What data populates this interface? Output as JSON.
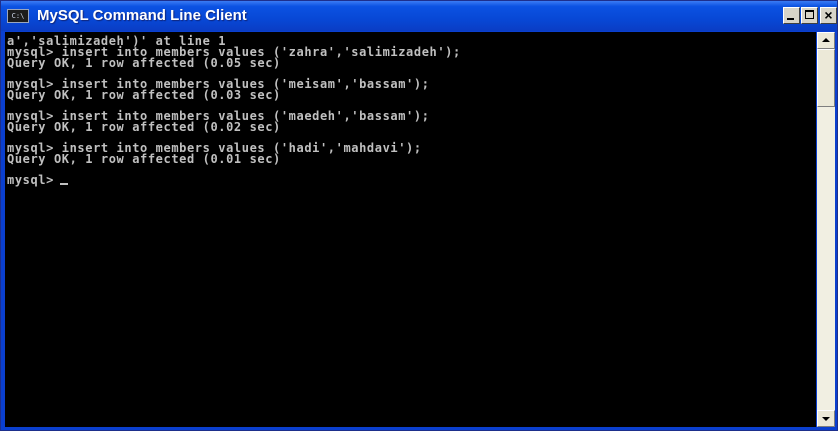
{
  "window": {
    "title": "MySQL Command Line Client",
    "system_icon_text": "C:\\",
    "buttons": {
      "minimize": "minimize-icon",
      "maximize": "maximize-icon",
      "close": "close-icon",
      "close_label": "×"
    }
  },
  "console": {
    "lines": [
      "a','salimizadeh')' at line 1",
      "mysql> insert into members values ('zahra','salimizadeh');",
      "Query OK, 1 row affected (0.05 sec)",
      "",
      "mysql> insert into members values ('meisam','bassam');",
      "Query OK, 1 row affected (0.03 sec)",
      "",
      "mysql> insert into members values ('maedeh','bassam');",
      "Query OK, 1 row affected (0.02 sec)",
      "",
      "mysql> insert into members values ('hadi','mahdavi');",
      "Query OK, 1 row affected (0.01 sec)",
      ""
    ],
    "prompt": "mysql>",
    "colors": {
      "background": "#000000",
      "text": "#c0c0c0"
    }
  },
  "scrollbar": {
    "up_arrow": "scroll-up-arrow-icon",
    "down_arrow": "scroll-down-arrow-icon"
  },
  "colors": {
    "titlebar": "#0848d6",
    "title_text": "#ffffff"
  }
}
